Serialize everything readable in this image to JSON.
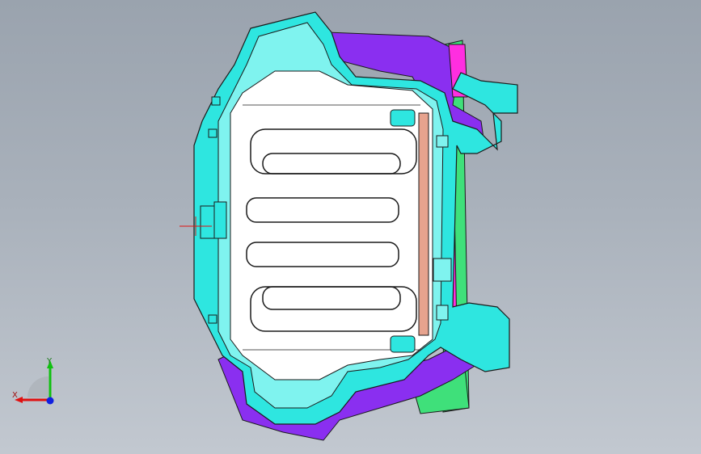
{
  "viewport": {
    "background_top": "#9aa3ae",
    "background_bottom": "#c2c8d0"
  },
  "model": {
    "colors": {
      "cyan_panel": "#2ee6e0",
      "cyan_light": "#7ff3ef",
      "magenta_panel": "#ff2ee0",
      "purple_panel": "#8a2ff0",
      "green_frame": "#3fe07a",
      "floor_white": "#ffffff",
      "edge_black": "#1a1a1a",
      "copper_rail": "#e7a38e"
    },
    "cross_marker_color": "#e01010"
  },
  "triad": {
    "x_label": "X",
    "y_label": "Y",
    "x_color": "#e01010",
    "y_color": "#10c010",
    "z_color": "#1020e0"
  }
}
